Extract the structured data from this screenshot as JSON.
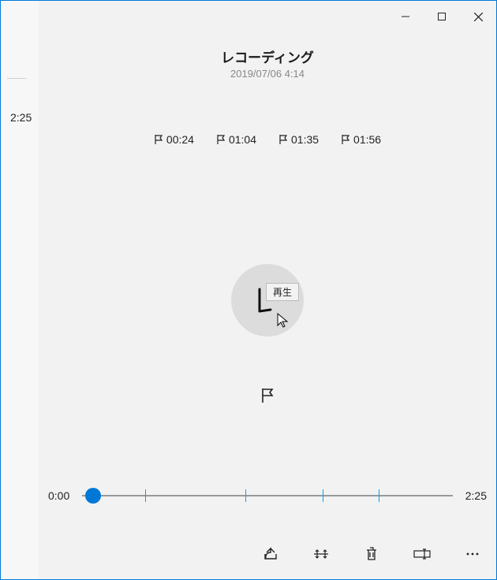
{
  "window": {
    "title": "レコーディング",
    "date": "2019/07/06 4:14"
  },
  "sidebar": {
    "duration": "2:25"
  },
  "markers": [
    {
      "time": "00:24"
    },
    {
      "time": "01:04"
    },
    {
      "time": "01:35"
    },
    {
      "time": "01:56"
    }
  ],
  "play": {
    "tooltip": "再生"
  },
  "scrub": {
    "current": "0:00",
    "total": "2:25",
    "position_pct": 3,
    "ticks_pct": [
      17,
      44,
      65,
      80
    ]
  }
}
